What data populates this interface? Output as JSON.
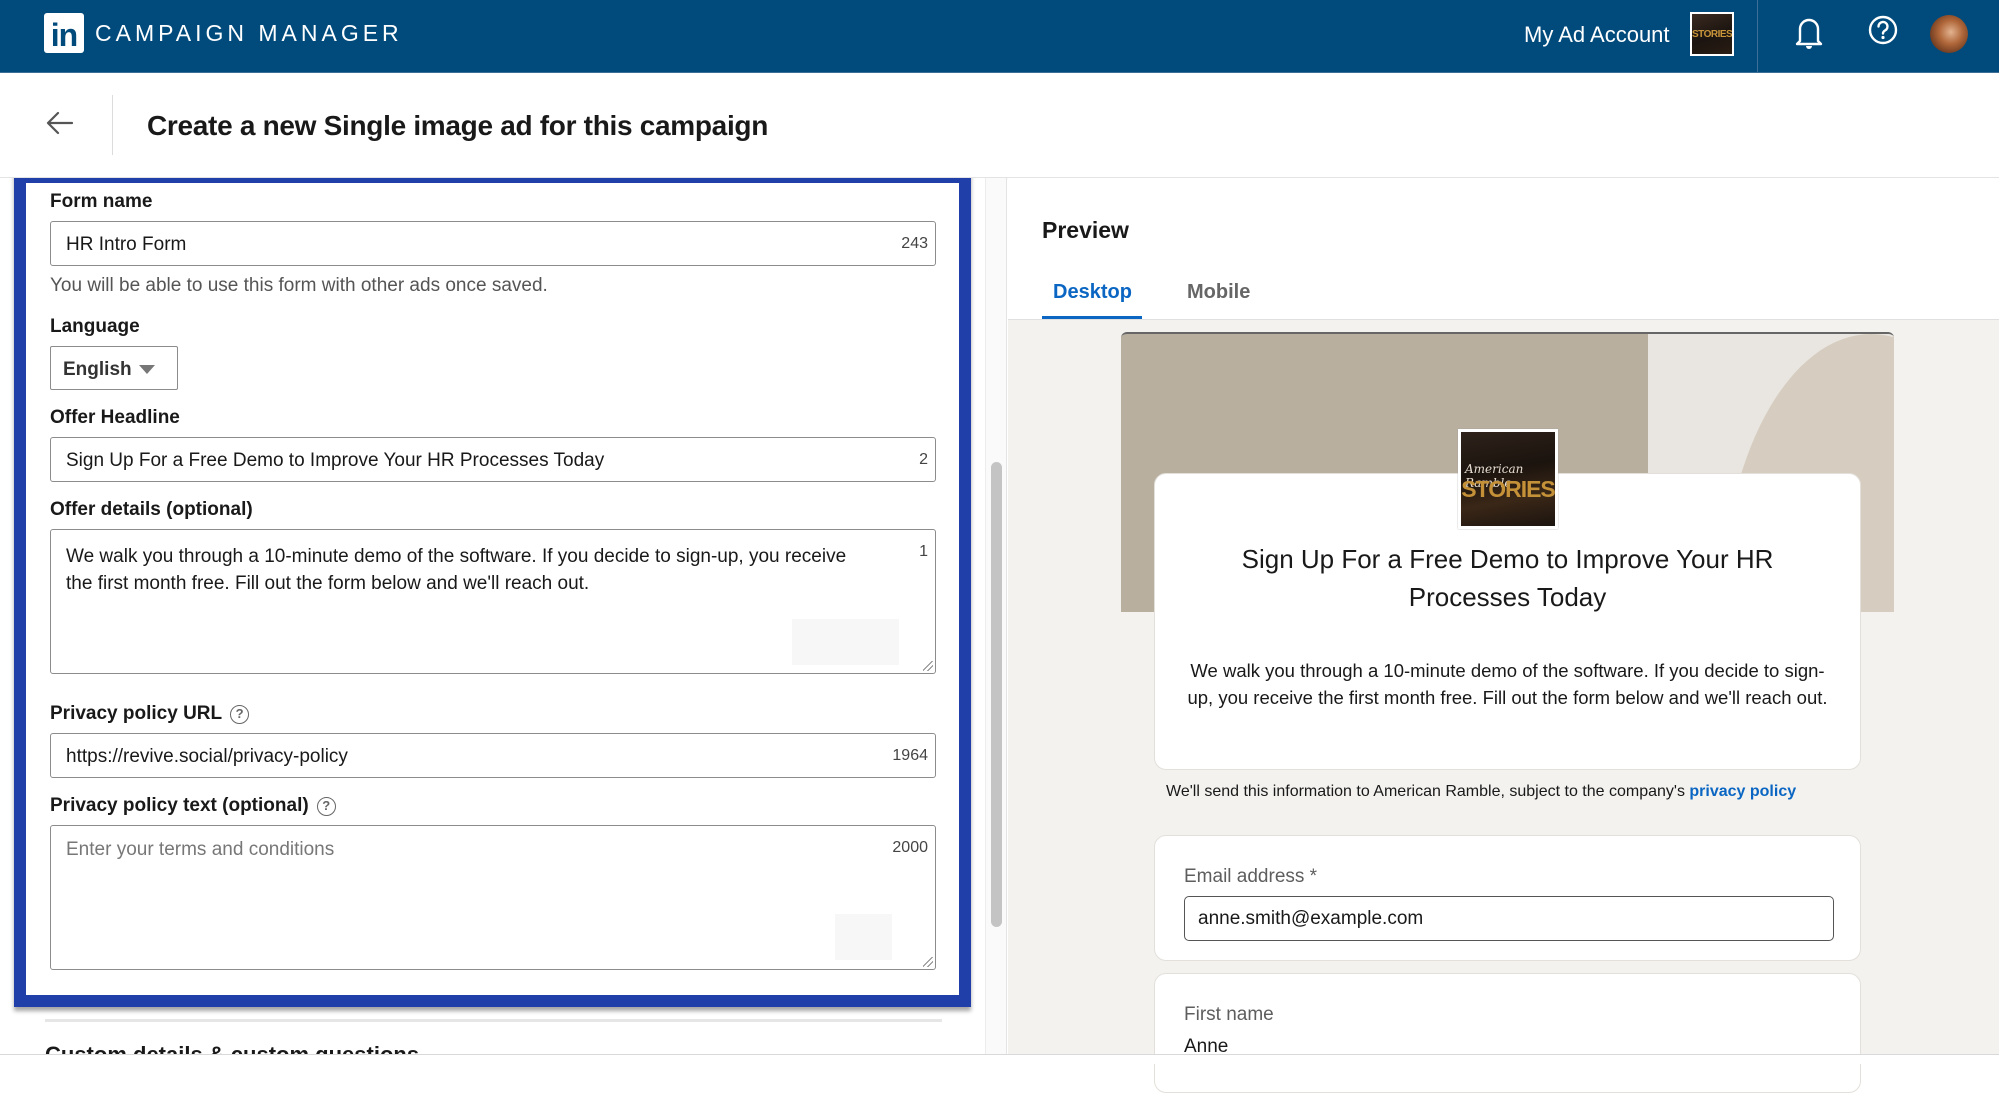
{
  "topbar": {
    "logo_text": "in",
    "brand": "CAMPAIGN MANAGER",
    "account_name": "My Ad Account",
    "account_thumb_text": "STORIES",
    "icons": [
      "bell-icon",
      "help-icon",
      "avatar"
    ]
  },
  "titlebar": {
    "back_icon": "arrow-left-icon",
    "title": "Create a new Single image ad for this campaign"
  },
  "form": {
    "form_name": {
      "label": "Form name",
      "value": "HR Intro Form",
      "remaining": "243",
      "hint": "You will be able to use this form with other ads once saved."
    },
    "language": {
      "label": "Language",
      "value": "English"
    },
    "offer_headline": {
      "label": "Offer Headline",
      "value": "Sign Up For a Free Demo to Improve Your HR Processes Today",
      "remaining": "2"
    },
    "offer_details": {
      "label": "Offer details (optional)",
      "value": "We walk you through a 10-minute demo of the software. If you decide to sign-up, you receive the first month free. Fill out the form below and we'll reach out.",
      "remaining": "1"
    },
    "privacy_url": {
      "label": "Privacy policy URL",
      "value": "https://revive.social/privacy-policy",
      "remaining": "1964",
      "help_icon": "question-circle-icon"
    },
    "privacy_text": {
      "label": "Privacy policy text (optional)",
      "placeholder": "Enter your terms and conditions",
      "remaining": "2000",
      "help_icon": "question-circle-icon"
    },
    "next_section_clipped": "Custom details & custom questions"
  },
  "preview": {
    "heading": "Preview",
    "tabs": [
      {
        "label": "Desktop",
        "active": true
      },
      {
        "label": "Mobile",
        "active": false
      }
    ],
    "card": {
      "logo_script": "American Ramble",
      "logo_text": "STORIES",
      "headline": "Sign Up For a Free Demo to Improve Your HR Processes Today",
      "details": "We walk you through a 10-minute demo of the software. If you decide to sign-up, you receive the first month free. Fill out the form below and we'll reach out."
    },
    "consent_text": "We'll send this information to American Ramble, subject to the company's ",
    "consent_link": "privacy policy",
    "questions": [
      {
        "label": "Email address *",
        "value": "anne.smith@example.com"
      },
      {
        "label": "First name",
        "value": "Anne"
      }
    ]
  },
  "colors": {
    "header_bg": "#004b7c",
    "highlight_border": "#213fa9",
    "accent_link": "#0a66c2"
  }
}
